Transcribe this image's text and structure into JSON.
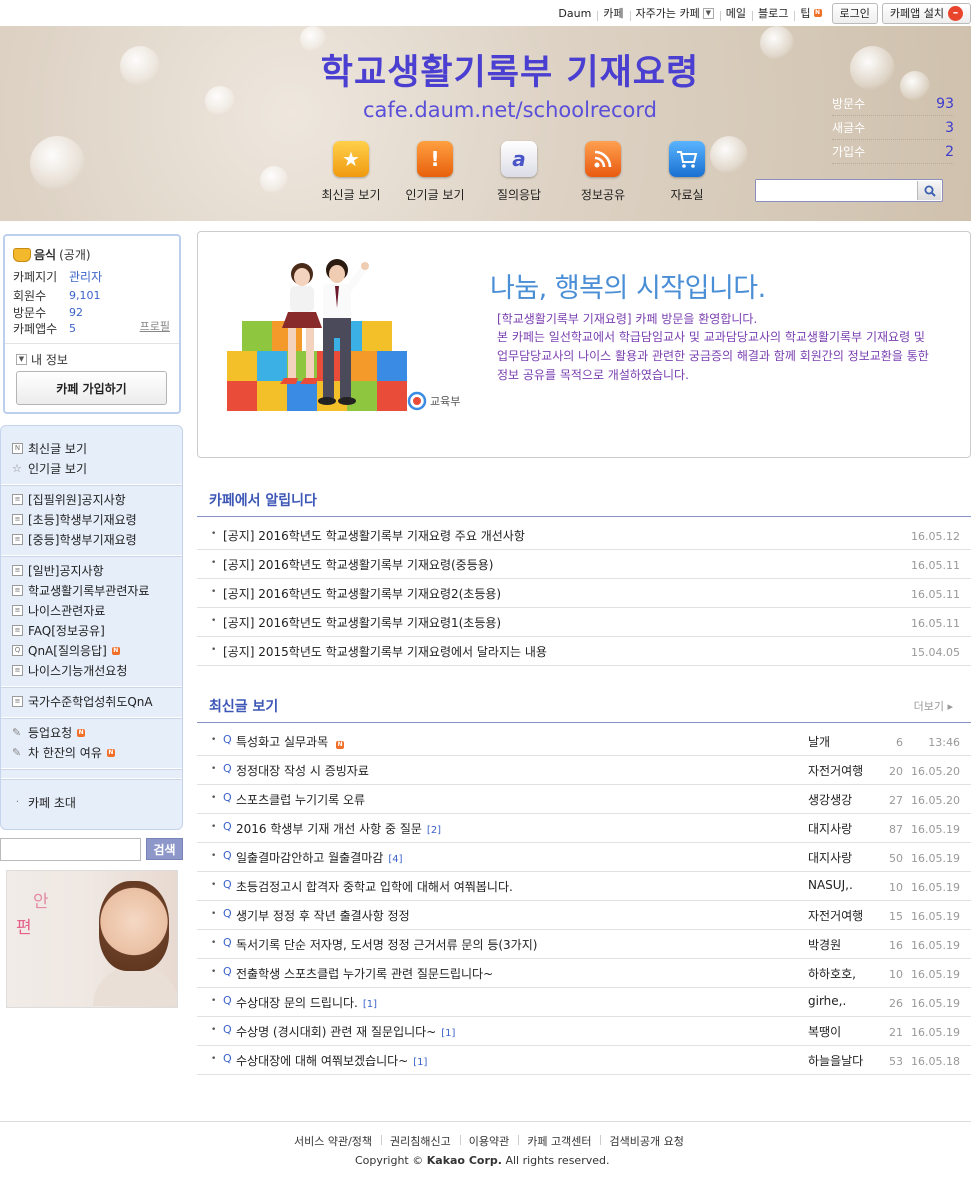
{
  "gnb": {
    "links": [
      "Daum",
      "카페",
      "자주가는 카페",
      "메일",
      "블로그",
      "팁"
    ],
    "login": "로그인",
    "app_install": "카페앱 설치"
  },
  "header": {
    "title": "학교생활기록부 기재요령",
    "url": "cafe.daum.net/schoolrecord",
    "quick": [
      {
        "label": "최신글 보기",
        "icon": "star-icon",
        "color": "#f4a818"
      },
      {
        "label": "인기글 보기",
        "icon": "exclamation-icon",
        "color": "#f07a1c"
      },
      {
        "label": "질의응답",
        "icon": "qna-icon",
        "color": "#e8e8f0"
      },
      {
        "label": "정보공유",
        "icon": "rss-icon",
        "color": "#f0701c"
      },
      {
        "label": "자료실",
        "icon": "cart-icon",
        "color": "#2a8de0"
      }
    ],
    "stats": [
      {
        "label": "방문수",
        "value": "93"
      },
      {
        "label": "새글수",
        "value": "3"
      },
      {
        "label": "가입수",
        "value": "2"
      }
    ],
    "search_placeholder": ""
  },
  "profile": {
    "category": "음식",
    "visibility": "(공개)",
    "rows": [
      {
        "label": "카페지기",
        "value": "관리자"
      },
      {
        "label": "회원수",
        "value": "9,101"
      },
      {
        "label": "방문수",
        "value": "92"
      },
      {
        "label": "카페앱수",
        "value": "5"
      }
    ],
    "profile_link": "프로필",
    "my_info": "내 정보",
    "join_button": "카페 가입하기"
  },
  "menu": {
    "groups": [
      [
        "최신글 보기",
        "인기글 보기"
      ],
      [
        "[집필위원]공지사항",
        "[초등]학생부기재요령",
        "[중등]학생부기재요령"
      ],
      [
        "[일반]공지사항",
        "학교생활기록부관련자료",
        "나이스관련자료",
        "FAQ[정보공유]",
        "QnA[질의응답]",
        "나이스기능개선요청"
      ],
      [
        "국가수준학업성취도QnA"
      ],
      [
        "등업요청",
        "차 한잔의 여유"
      ],
      [],
      [
        "카페 초대"
      ]
    ]
  },
  "left_search": {
    "button": "검색"
  },
  "banner": {
    "line1": "안",
    "line2": "편"
  },
  "welcome": {
    "heading": "나눔, 행복의 시작입니다.",
    "line1": "[학교생활기록부 기재요령] 카페 방문을 환영합니다.",
    "line2": "본 카페는 일선학교에서 학급담임교사 및 교과담당교사의 학교생활기록부 기재요령 및 업무담당교사의 나이스 활용과 관련한 궁금증의 해결과 함께 회원간의 정보교환을 통한 정보 공유를 목적으로 개설하였습니다.",
    "logo_text": "교육부"
  },
  "notice": {
    "title": "카페에서 알립니다",
    "items": [
      {
        "title": "[공지] 2016학년도 학교생활기록부 기재요령 주요 개선사항",
        "date": "16.05.12"
      },
      {
        "title": "[공지] 2016학년도 학교생활기록부 기재요령(중등용)",
        "date": "16.05.11"
      },
      {
        "title": "[공지] 2016학년도 학교생활기록부 기재요령2(초등용)",
        "date": "16.05.11"
      },
      {
        "title": "[공지] 2016학년도 학교생활기록부 기재요령1(초등용)",
        "date": "16.05.11"
      },
      {
        "title": "[공지] 2015학년도 학교생활기록부 기재요령에서 달라지는 내용",
        "date": "15.04.05"
      }
    ]
  },
  "recent": {
    "title": "최신글 보기",
    "more": "더보기 ▸",
    "items": [
      {
        "prefix": "Q",
        "title": "특성화고 실무과목",
        "comments": "",
        "new": true,
        "author": "날개",
        "views": "6",
        "date": "13:46"
      },
      {
        "prefix": "Q",
        "title": "정정대장 작성 시 증빙자료",
        "comments": "",
        "new": false,
        "author": "자전거여행",
        "views": "20",
        "date": "16.05.20"
      },
      {
        "prefix": "Q",
        "title": "스포츠클럽 누기기록 오류",
        "comments": "",
        "new": false,
        "author": "생강생강",
        "views": "27",
        "date": "16.05.20"
      },
      {
        "prefix": "Q",
        "title": "2016 학생부 기재 개선 사항 중 질문",
        "comments": "[2]",
        "new": false,
        "author": "대지사랑",
        "views": "87",
        "date": "16.05.19"
      },
      {
        "prefix": "Q",
        "title": "일출결마감안하고 월출결마감",
        "comments": "[4]",
        "new": false,
        "author": "대지사랑",
        "views": "50",
        "date": "16.05.19"
      },
      {
        "prefix": "Q",
        "title": "초등검정고시 합격자 중학교 입학에 대해서 여쭤봅니다.",
        "comments": "",
        "new": false,
        "author": "NASUJ,.",
        "views": "10",
        "date": "16.05.19"
      },
      {
        "prefix": "Q",
        "title": "생기부 정정 후 작년 출결사항 정정",
        "comments": "",
        "new": false,
        "author": "자전거여행",
        "views": "15",
        "date": "16.05.19"
      },
      {
        "prefix": "Q",
        "title": "독서기록 단순 저자명, 도서명 정정 근거서류 문의 등(3가지)",
        "comments": "",
        "new": false,
        "author": "박경원",
        "views": "16",
        "date": "16.05.19"
      },
      {
        "prefix": "Q",
        "title": "전출학생 스포츠클럽 누가기록 관련 질문드립니다~",
        "comments": "",
        "new": false,
        "author": "하하호호,",
        "views": "10",
        "date": "16.05.19"
      },
      {
        "prefix": "Q",
        "title": "수상대장 문의 드립니다.",
        "comments": "[1]",
        "new": false,
        "author": "girhe,.",
        "views": "26",
        "date": "16.05.19"
      },
      {
        "prefix": "Q",
        "title": "수상명 (경시대회) 관련 재 질문입니다~",
        "comments": "[1]",
        "new": false,
        "author": "복땡이",
        "views": "21",
        "date": "16.05.19"
      },
      {
        "prefix": "Q",
        "title": "수상대장에 대해 여쭤보겠습니다~",
        "comments": "[1]",
        "new": false,
        "author": "하늘을날다",
        "views": "53",
        "date": "16.05.18"
      }
    ]
  },
  "footer": {
    "links": [
      "서비스 약관/정책",
      "권리침해신고",
      "이용약관",
      "카페 고객센터",
      "검색비공개 요청"
    ],
    "copyright_pre": "Copyright ©",
    "copyright_company": "Kakao Corp.",
    "copyright_post": "All rights reserved."
  }
}
